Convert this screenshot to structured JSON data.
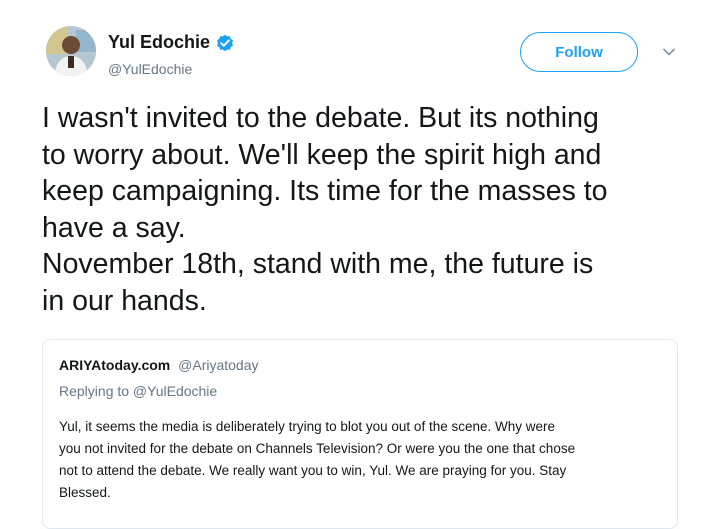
{
  "author": {
    "display_name": "Yul Edochie",
    "handle": "@YulEdochie",
    "verified": true
  },
  "actions": {
    "follow_label": "Follow"
  },
  "tweet": {
    "lines": [
      "I wasn't invited to the debate. But its nothing",
      "to worry about. We'll keep the spirit high and",
      "keep campaigning. Its time for the masses to",
      "have a say.",
      "November 18th, stand with me, the future is",
      "in our hands."
    ]
  },
  "quoted_tweet": {
    "display_name": "ARIYAtoday.com",
    "handle": "@Ariyatoday",
    "replying_to": "Replying to @YulEdochie",
    "lines": [
      "Yul, it seems the media is deliberately trying to blot you out of the scene. Why were",
      "you not invited for the debate on Channels Television? Or were you the one that chose",
      "not to attend the debate. We really want you to win, Yul. We are praying for you. Stay",
      "Blessed."
    ]
  },
  "colors": {
    "accent": "#1da1f2",
    "text": "#14171a",
    "secondary_text": "#657786",
    "border": "#e1e8ed"
  },
  "icons": {
    "verified": "verified-badge-icon",
    "menu": "chevron-down-icon"
  }
}
